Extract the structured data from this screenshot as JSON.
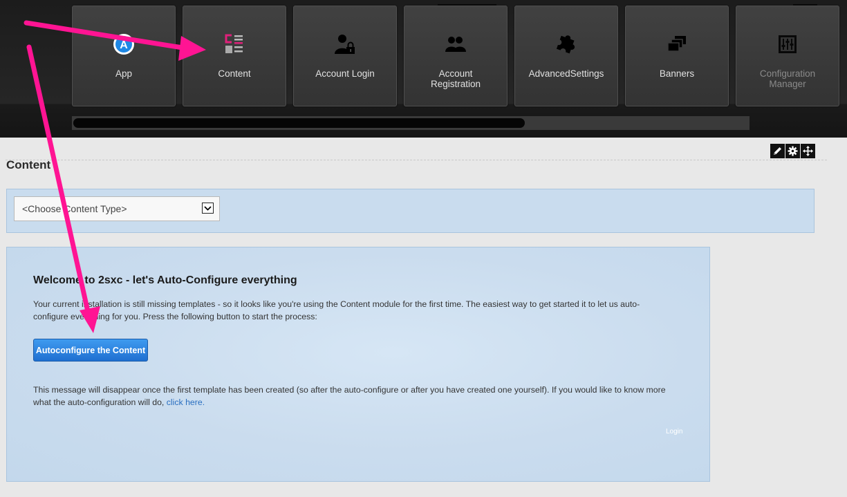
{
  "ribbon": {
    "tiles": [
      {
        "label": "App",
        "icon": "app-icon"
      },
      {
        "label": "Content",
        "icon": "content-icon"
      },
      {
        "label": "Account Login",
        "icon": "user-lock-icon"
      },
      {
        "label": "Account\nRegistration",
        "icon": "users-icon"
      },
      {
        "label": "AdvancedSettings",
        "icon": "puzzle-icon"
      },
      {
        "label": "Banners",
        "icon": "banners-icon"
      },
      {
        "label": "Configuration\nManager",
        "icon": "sliders-icon"
      }
    ]
  },
  "module": {
    "title": "Content",
    "actions": [
      "pencil-icon",
      "gear-icon",
      "move-icon"
    ]
  },
  "content_type": {
    "selected": "<Choose Content Type>"
  },
  "welcome": {
    "heading": "Welcome to 2sxc - let's Auto-Configure everything",
    "intro": "Your current installation is still missing templates - so it looks like you're using the Content module for the first time. The easiest way to get started it to let us auto-configure everything for you. Press the following button to start the process:",
    "button": "Autoconfigure the Content",
    "note": "This message will disappear once the first template has been created (so after the auto-configure or after you have created one yourself). If you would like to know more what the auto-configuration will do, ",
    "link": "click here.",
    "login": "Login"
  },
  "colors": {
    "accent_pink": "#ff1493",
    "button_blue": "#2a83e3",
    "panel_blue": "#c9dcee"
  }
}
